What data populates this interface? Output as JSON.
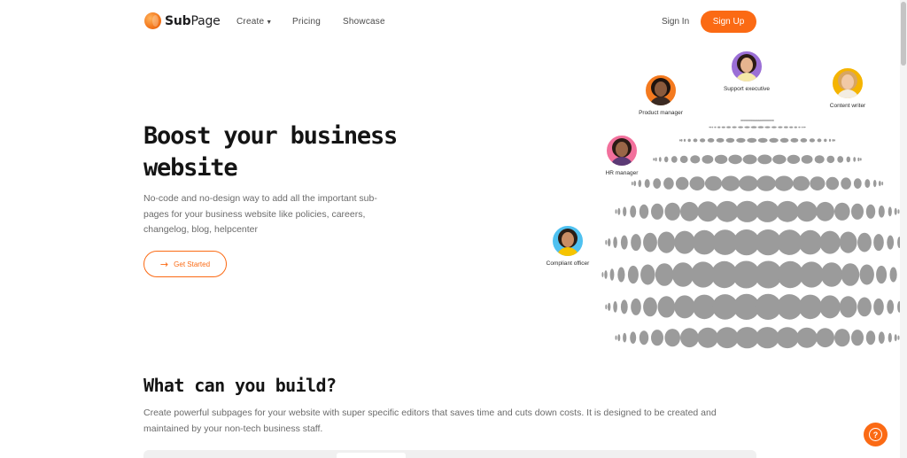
{
  "nav": {
    "brand_bold": "Sub",
    "brand_rest": "Page",
    "links": [
      {
        "label": "Create",
        "has_caret": true
      },
      {
        "label": "Pricing"
      },
      {
        "label": "Showcase"
      }
    ],
    "signin_label": "Sign In",
    "signup_label": "Sign Up"
  },
  "hero": {
    "title_line1": "Boost your business",
    "title_line2": "website",
    "subtitle": "No-code and no-design way to add all the important sub-pages for your business website like policies, careers, changelog, blog, helpcenter",
    "cta_label": "Get Started",
    "cta_icon": "arrow-right-icon"
  },
  "personas": [
    {
      "label": "Support executive",
      "ring": "#9b6fd6"
    },
    {
      "label": "Content writer",
      "ring": "#f5b400"
    },
    {
      "label": "Product manager",
      "ring": "#f47a1f"
    },
    {
      "label": "HR manager",
      "ring": "#f2709c"
    },
    {
      "label": "Compliant officer",
      "ring": "#4fc1f0"
    }
  ],
  "section": {
    "title": "What can you build?",
    "description": "Create powerful subpages for your website with super specific editors that saves time and cuts down costs. It is designed to be created and maintained by your non-tech business staff."
  },
  "colors": {
    "accent": "#fb6a14",
    "sphere_dot": "#9b9b9b"
  },
  "help_icon": "help-circle-icon",
  "help_glyph": "?"
}
